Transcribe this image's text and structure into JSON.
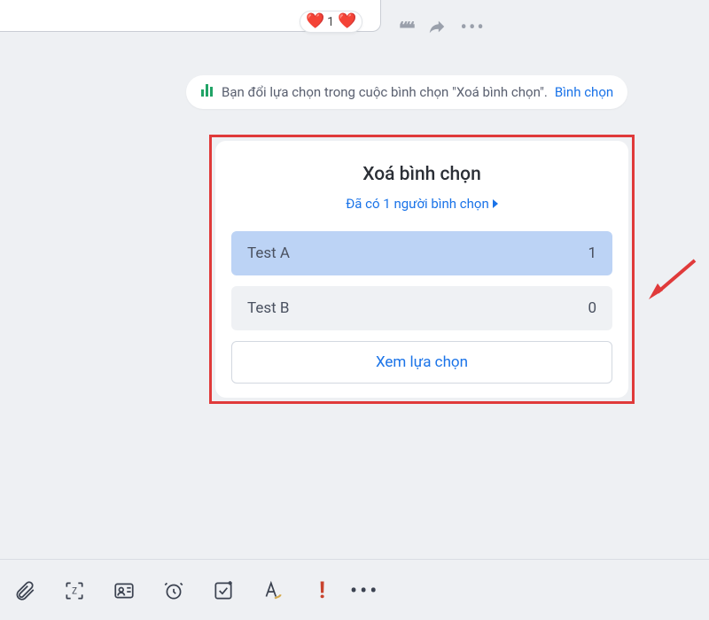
{
  "reactions": {
    "count": "1"
  },
  "system_message": {
    "text": "Bạn đổi lựa chọn trong cuộc bình chọn \"Xoá bình chọn\".",
    "link": "Bình chọn"
  },
  "poll": {
    "title": "Xoá bình chọn",
    "subtitle": "Đã có 1 người bình chọn",
    "options": [
      {
        "label": "Test A",
        "count": "1"
      },
      {
        "label": "Test B",
        "count": "0"
      }
    ],
    "view_button": "Xem lựa chọn"
  },
  "toolbar": {
    "bang": "!"
  }
}
